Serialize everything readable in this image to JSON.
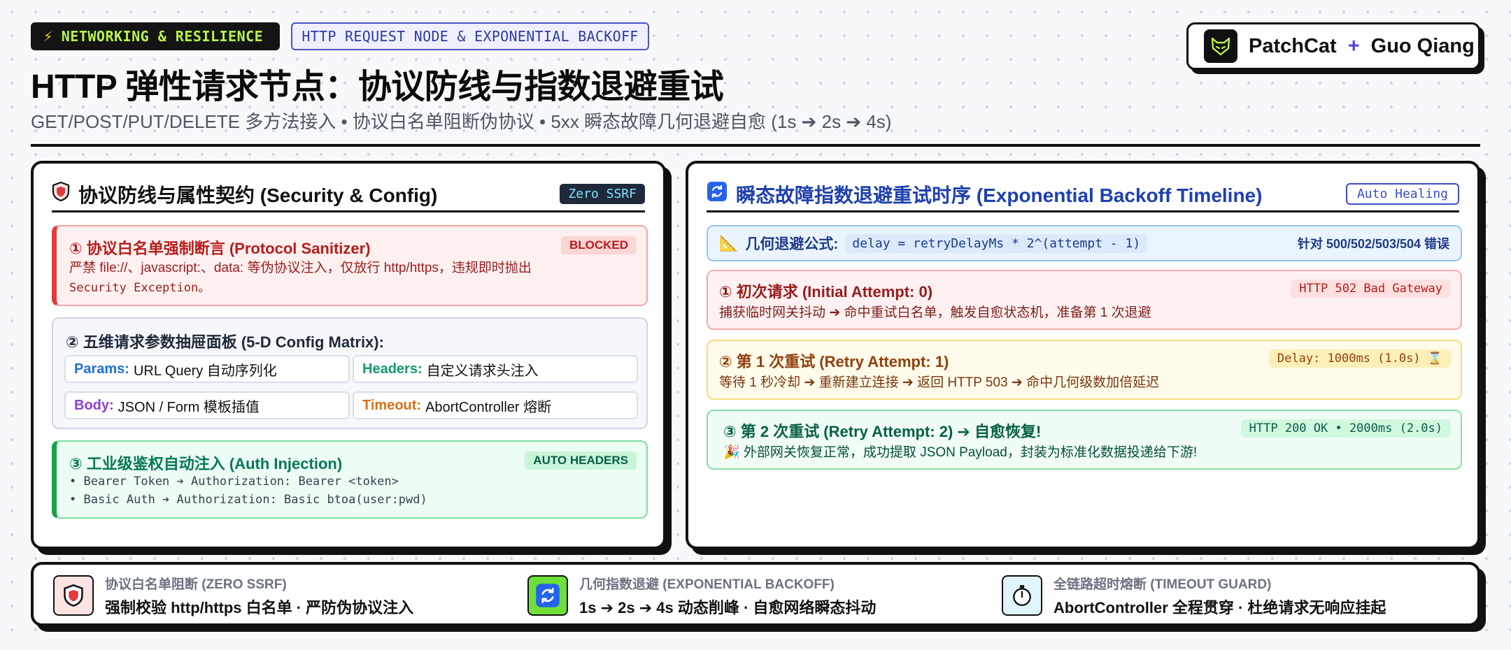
{
  "header": {
    "tag_dark": "NETWORKING & RESILIENCE",
    "tag_outline": "HTTP REQUEST NODE & EXPONENTIAL BACKOFF",
    "title": "HTTP 弹性请求节点：协议防线与指数退避重试",
    "subtitle": "GET/POST/PUT/DELETE 多方法接入 • 协议白名单阻断伪协议 • 5xx 瞬态故障几何退避自愈 (1s ➔ 2s ➔ 4s)"
  },
  "brand": {
    "name": "PatchCat",
    "plus": "+",
    "author": "Guo Qiang"
  },
  "left_panel": {
    "title": "协议防线与属性契约 (Security & Config)",
    "chip": "Zero SSRF",
    "sanitizer": {
      "title": "① 协议白名单强制断言 (Protocol Sanitizer)",
      "badge": "BLOCKED",
      "line1": "严禁 file://、javascript:、data: 等伪协议注入，仅放行 http/https，违规即时抛出",
      "line2": "Security Exception。"
    },
    "matrix": {
      "title": "② 五维请求参数抽屉面板 (5-D Config Matrix):",
      "cells": [
        {
          "key": "Params:",
          "value": "URL Query 自动序列化",
          "color": "#1d6fd6"
        },
        {
          "key": "Headers:",
          "value": "自定义请求头注入",
          "color": "#0f9b6b"
        },
        {
          "key": "Body:",
          "value": "JSON / Form 模板插值",
          "color": "#8b3fd9"
        },
        {
          "key": "Timeout:",
          "value": "AbortController 熔断",
          "color": "#d9731a"
        }
      ]
    },
    "auth": {
      "title": "③ 工业级鉴权自动注入 (Auth Injection)",
      "badge": "AUTO HEADERS",
      "line1": "• Bearer Token ➔ Authorization: Bearer <token>",
      "line2": "• Basic Auth ➔ Authorization: Basic btoa(user:pwd)"
    }
  },
  "right_panel": {
    "title": "瞬态故障指数退避重试时序 (Exponential Backoff Timeline)",
    "chip": "Auto Healing",
    "formula": {
      "label": "几何退避公式:",
      "code": "delay = retryDelayMs * 2^(attempt - 1)",
      "right": "针对 500/502/503/504 错误"
    },
    "steps": [
      {
        "title": "① 初次请求 (Initial Attempt: 0)",
        "badge": "HTTP 502 Bad Gateway",
        "desc": "捕获临时网关抖动 ➔ 命中重试白名单，触发自愈状态机，准备第 1 次退避"
      },
      {
        "title": "② 第 1 次重试 (Retry Attempt: 1)",
        "badge": "Delay: 1000ms (1.0s) ⌛",
        "desc": "等待 1 秒冷却 ➔ 重新建立连接 ➔ 返回 HTTP 503 ➔ 命中几何级数加倍延迟"
      },
      {
        "title": "③ 第 2 次重试 (Retry Attempt: 2) ➔ 自愈恢复!",
        "badge": "HTTP 200 OK • 2000ms (2.0s)",
        "desc": "🎉 外部网关恢复正常，成功提取 JSON Payload，封装为标准化数据投递给下游!"
      }
    ]
  },
  "footer": [
    {
      "label": "协议白名单阻断 (ZERO SSRF)",
      "desc": "强制校验 http/https 白名单 · 严防伪协议注入"
    },
    {
      "label": "几何指数退避 (EXPONENTIAL BACKOFF)",
      "desc": "1s ➔ 2s ➔ 4s 动态削峰 · 自愈网络瞬态抖动"
    },
    {
      "label": "全链路超时熔断 (TIMEOUT GUARD)",
      "desc": "AbortController 全程贯穿 · 杜绝请求无响应挂起"
    }
  ],
  "colors": {
    "accent_green": "#b8f34a",
    "danger": "#e23b3b",
    "success": "#16a34a",
    "info": "#1e40af"
  }
}
